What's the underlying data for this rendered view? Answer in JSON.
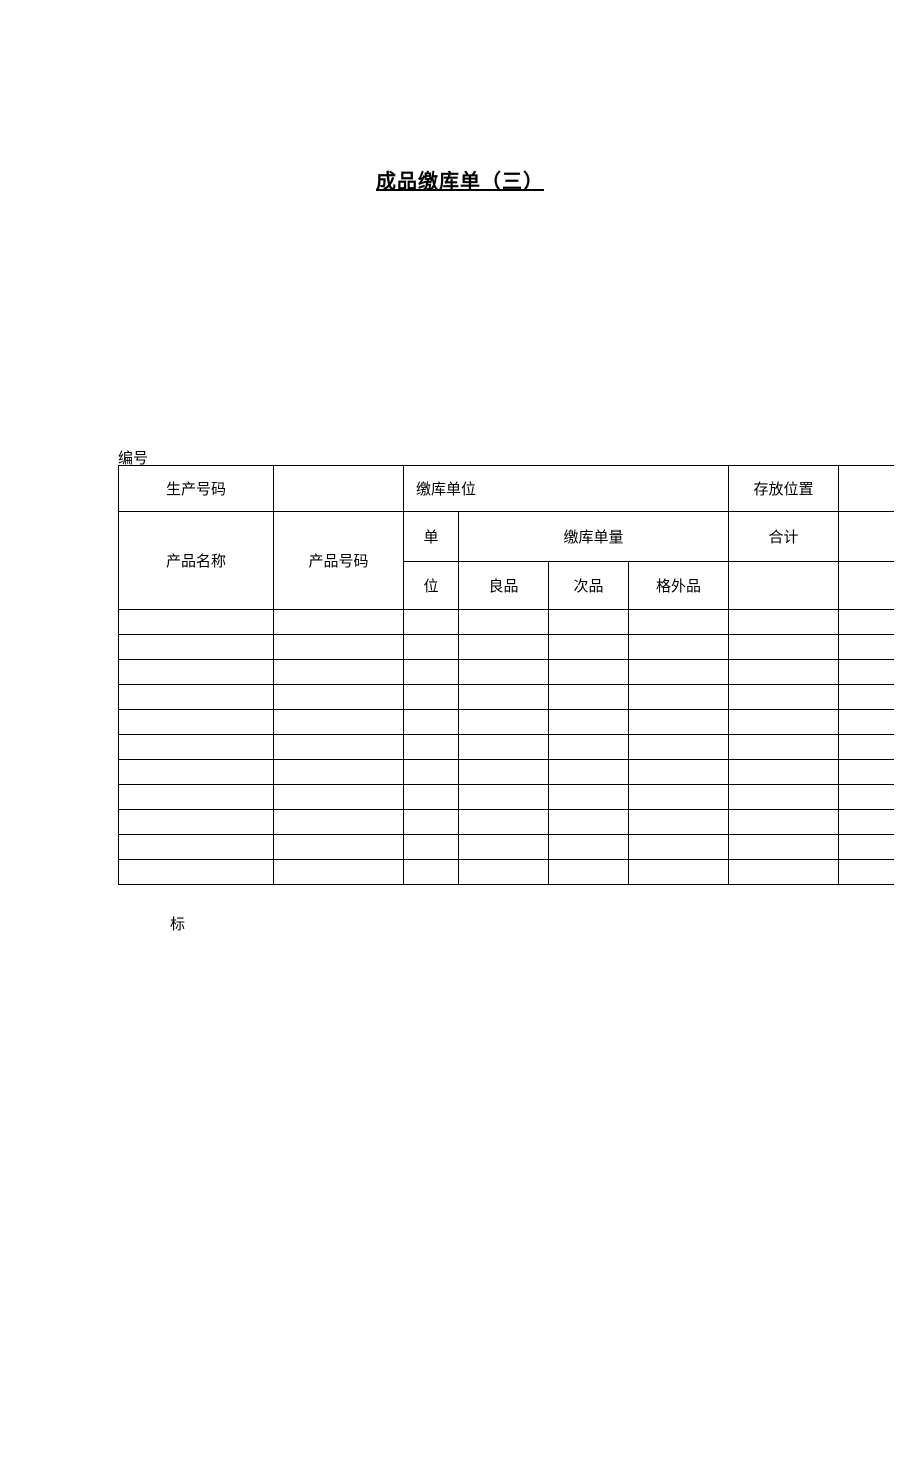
{
  "title": "成品缴库单（三）",
  "serialLabel": "编号",
  "headers": {
    "productionNumber": "生产号码",
    "depositUnit": "缴库单位",
    "storageLocation": "存放位置",
    "productName": "产品名称",
    "productNumber": "产品号码",
    "unitTop": "单",
    "unitBottom": "位",
    "depositQuantity": "缴库单量",
    "good": "良品",
    "defective": "次品",
    "extra": "格外品",
    "total": "合计"
  },
  "rows": [
    {
      "productName": "",
      "productNumber": "",
      "unit": "",
      "good": "",
      "defective": "",
      "extra": "",
      "total": "",
      "blank": ""
    },
    {
      "productName": "",
      "productNumber": "",
      "unit": "",
      "good": "",
      "defective": "",
      "extra": "",
      "total": "",
      "blank": ""
    },
    {
      "productName": "",
      "productNumber": "",
      "unit": "",
      "good": "",
      "defective": "",
      "extra": "",
      "total": "",
      "blank": ""
    },
    {
      "productName": "",
      "productNumber": "",
      "unit": "",
      "good": "",
      "defective": "",
      "extra": "",
      "total": "",
      "blank": ""
    },
    {
      "productName": "",
      "productNumber": "",
      "unit": "",
      "good": "",
      "defective": "",
      "extra": "",
      "total": "",
      "blank": ""
    },
    {
      "productName": "",
      "productNumber": "",
      "unit": "",
      "good": "",
      "defective": "",
      "extra": "",
      "total": "",
      "blank": ""
    },
    {
      "productName": "",
      "productNumber": "",
      "unit": "",
      "good": "",
      "defective": "",
      "extra": "",
      "total": "",
      "blank": ""
    },
    {
      "productName": "",
      "productNumber": "",
      "unit": "",
      "good": "",
      "defective": "",
      "extra": "",
      "total": "",
      "blank": ""
    },
    {
      "productName": "",
      "productNumber": "",
      "unit": "",
      "good": "",
      "defective": "",
      "extra": "",
      "total": "",
      "blank": ""
    },
    {
      "productName": "",
      "productNumber": "",
      "unit": "",
      "good": "",
      "defective": "",
      "extra": "",
      "total": "",
      "blank": ""
    },
    {
      "productName": "",
      "productNumber": "",
      "unit": "",
      "good": "",
      "defective": "",
      "extra": "",
      "total": "",
      "blank": ""
    }
  ],
  "footerLabel": "标"
}
